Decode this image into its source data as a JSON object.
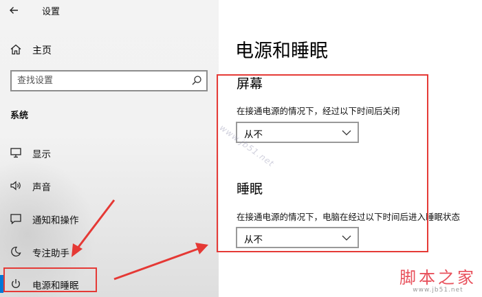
{
  "window": {
    "app_title": "设置"
  },
  "sidebar": {
    "home_label": "主页",
    "search_placeholder": "查找设置",
    "section_label": "系统",
    "items": [
      {
        "label": "显示",
        "icon": "monitor-icon"
      },
      {
        "label": "声音",
        "icon": "speaker-icon"
      },
      {
        "label": "通知和操作",
        "icon": "message-icon"
      },
      {
        "label": "专注助手",
        "icon": "moon-icon"
      },
      {
        "label": "电源和睡眠",
        "icon": "power-icon",
        "active": true
      }
    ]
  },
  "main": {
    "title": "电源和睡眠",
    "screen": {
      "title": "屏幕",
      "description": "在接通电源的情况下，经过以下时间后关闭",
      "value": "从不"
    },
    "sleep": {
      "title": "睡眠",
      "description": "在接通电源的情况下，电脑在经过以下时间后进入睡眠状态",
      "value": "从不"
    }
  },
  "watermarks": {
    "diagonal": "www.jb51.net",
    "logo_text": "脚本之家",
    "logo_url": "www.jb51.net"
  },
  "colors": {
    "accent": "#0078d7",
    "annotation": "#e53935",
    "logo": "#e8505b"
  }
}
